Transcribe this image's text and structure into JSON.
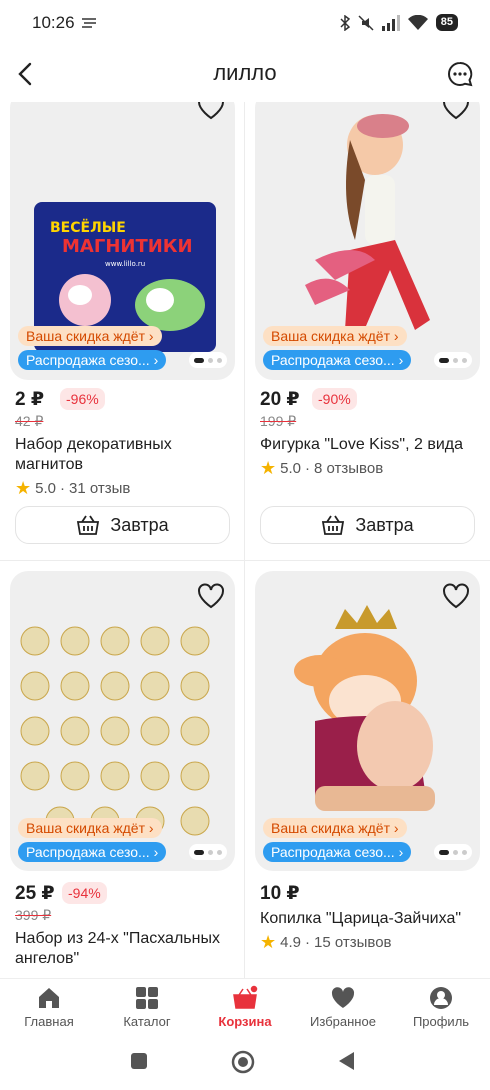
{
  "status": {
    "time": "10:26",
    "battery": "85"
  },
  "header": {
    "title": "лилло"
  },
  "products": [
    {
      "price": "2 ₽",
      "discount": "-96%",
      "old_price": "42 ₽",
      "name": "Набор декоративных магнитов",
      "rating": "5.0",
      "reviews": "31 отзыв",
      "promo": "Ваша скидка ждёт",
      "sale": "Распродажа сезо...",
      "delivery": "Завтра",
      "image_text": {
        "line1": "ВЕСЁЛЫЕ",
        "line2": "МАГНИТИКИ",
        "url": "www.lillo.ru"
      }
    },
    {
      "price": "20 ₽",
      "discount": "-90%",
      "old_price": "199 ₽",
      "name": "Фигурка \"Love Kiss\", 2 вида",
      "rating": "5.0",
      "reviews": "8 отзывов",
      "promo": "Ваша скидка ждёт",
      "sale": "Распродажа сезо...",
      "delivery": "Завтра"
    },
    {
      "price": "25 ₽",
      "discount": "-94%",
      "old_price": "399 ₽",
      "name": "Набор из 24-х \"Пасхальных ангелов\"",
      "promo": "Ваша скидка ждёт",
      "sale": "Распродажа сезо..."
    },
    {
      "price": "10 ₽",
      "name": "Копилка \"Царица-Зайчиха\"",
      "rating": "4.9",
      "reviews": "15 отзывов",
      "promo": "Ваша скидка ждёт",
      "sale": "Распродажа сезо..."
    }
  ],
  "tabs": [
    {
      "label": "Главная",
      "icon": "home-icon"
    },
    {
      "label": "Каталог",
      "icon": "catalog-icon"
    },
    {
      "label": "Корзина",
      "icon": "cart-icon",
      "active": true
    },
    {
      "label": "Избранное",
      "icon": "heart-icon"
    },
    {
      "label": "Профиль",
      "icon": "profile-icon"
    }
  ],
  "colors": {
    "accent": "#e8323c",
    "sale": "#2e9cf0",
    "promo_bg": "#fde0c4",
    "promo_text": "#d44a00",
    "star": "#f5b300"
  }
}
